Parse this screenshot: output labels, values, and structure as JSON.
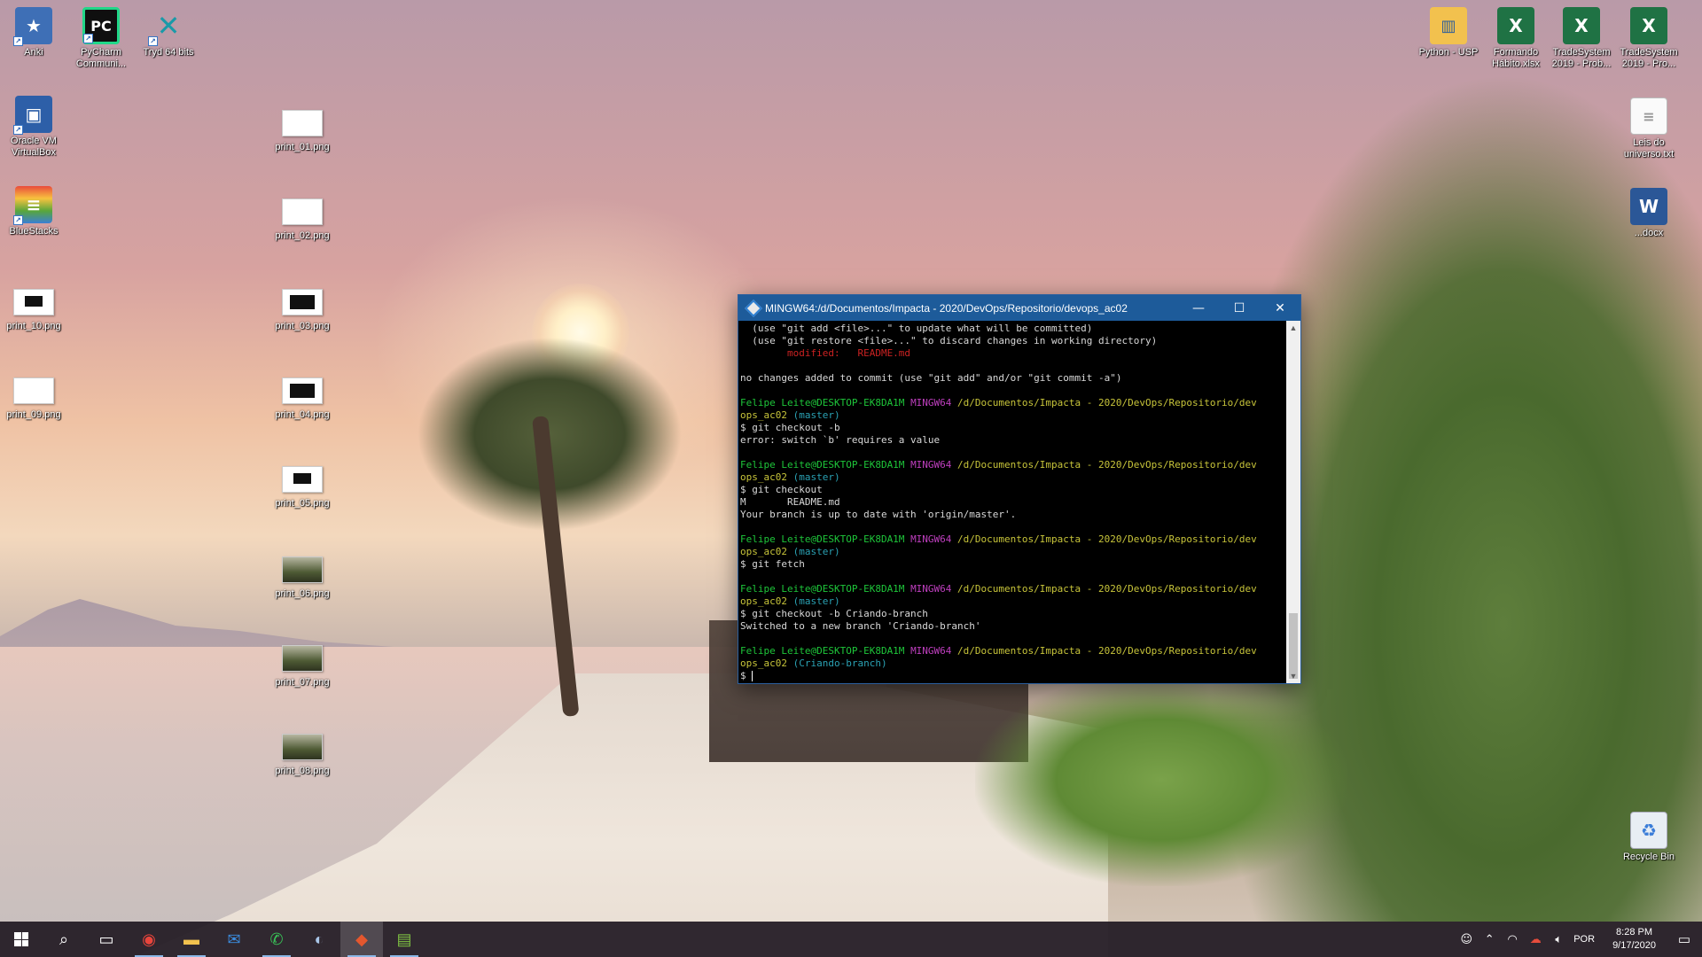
{
  "desktop": {
    "icons_left": [
      {
        "label": "Anki",
        "icon": "anki-icon",
        "color": "#3e6fb6"
      },
      {
        "label": "PyCharm Communi...",
        "icon": "pycharm-icon",
        "color": "#0f0f0f"
      },
      {
        "label": "Tryd 64 bits",
        "icon": "tryd-icon",
        "color": "#1a7f8a"
      },
      {
        "label": "Oracle VM VirtualBox",
        "icon": "virtualbox-icon",
        "color": "#2d5fa8"
      },
      {
        "label": "BlueStacks",
        "icon": "bluestacks-icon",
        "color": "#58a63b"
      },
      {
        "label": "print_10.png",
        "icon": "image-file-icon"
      },
      {
        "label": "print_09.png",
        "icon": "image-file-icon"
      }
    ],
    "icons_prints": [
      {
        "label": "print_01.png"
      },
      {
        "label": "print_02.png"
      },
      {
        "label": "print_03.png"
      },
      {
        "label": "print_04.png"
      },
      {
        "label": "print_05.png"
      },
      {
        "label": "print_06.png"
      },
      {
        "label": "print_07.png"
      },
      {
        "label": "print_08.png"
      }
    ],
    "icons_right": [
      {
        "label": "Python - USP",
        "icon": "folder-icon"
      },
      {
        "label": "Formando Hábito.xlsx",
        "icon": "excel-icon"
      },
      {
        "label": "TradeSystem 2019 - Prob...",
        "icon": "excel-icon"
      },
      {
        "label": "TradeSystem 2019 - Pro...",
        "icon": "excel-icon"
      },
      {
        "label": "Leis do universo.txt",
        "icon": "text-file-icon"
      },
      {
        "label": "...docx",
        "icon": "word-icon"
      },
      {
        "label": "Recycle Bin",
        "icon": "recycle-bin-icon"
      }
    ]
  },
  "terminal": {
    "title": "MINGW64:/d/Documentos/Impacta - 2020/DevOps/Repositorio/devops_ac02",
    "minimize": "—",
    "maximize": "☐",
    "close": "✕",
    "lines": [
      {
        "text": "  (use \"git add <file>...\" to update what will be committed)"
      },
      {
        "text": "  (use \"git restore <file>...\" to discard changes in working directory)"
      },
      {
        "text": "        modified:   README.md",
        "color": "red"
      },
      {
        "text": ""
      },
      {
        "text": "no changes added to commit (use \"git add\" and/or \"git commit -a\")"
      },
      {
        "text": ""
      },
      {
        "prompt": true,
        "user": "Felipe Leite@DESKTOP-EK8DA1M",
        "env": "MINGW64",
        "path": "/d/Documentos/Impacta - 2020/DevOps/Repositorio/dev",
        "path2": "ops_ac02",
        "branch": "(master)"
      },
      {
        "text": "$ git checkout -b"
      },
      {
        "text": "error: switch `b' requires a value"
      },
      {
        "text": ""
      },
      {
        "prompt": true,
        "user": "Felipe Leite@DESKTOP-EK8DA1M",
        "env": "MINGW64",
        "path": "/d/Documentos/Impacta - 2020/DevOps/Repositorio/dev",
        "path2": "ops_ac02",
        "branch": "(master)"
      },
      {
        "text": "$ git checkout"
      },
      {
        "text": "M       README.md"
      },
      {
        "text": "Your branch is up to date with 'origin/master'."
      },
      {
        "text": ""
      },
      {
        "prompt": true,
        "user": "Felipe Leite@DESKTOP-EK8DA1M",
        "env": "MINGW64",
        "path": "/d/Documentos/Impacta - 2020/DevOps/Repositorio/dev",
        "path2": "ops_ac02",
        "branch": "(master)"
      },
      {
        "text": "$ git fetch"
      },
      {
        "text": ""
      },
      {
        "prompt": true,
        "user": "Felipe Leite@DESKTOP-EK8DA1M",
        "env": "MINGW64",
        "path": "/d/Documentos/Impacta - 2020/DevOps/Repositorio/dev",
        "path2": "ops_ac02",
        "branch": "(master)"
      },
      {
        "text": "$ git checkout -b Criando-branch"
      },
      {
        "text": "Switched to a new branch 'Criando-branch'"
      },
      {
        "text": ""
      },
      {
        "prompt": true,
        "user": "Felipe Leite@DESKTOP-EK8DA1M",
        "env": "MINGW64",
        "path": "/d/Documentos/Impacta - 2020/DevOps/Repositorio/dev",
        "path2": "ops_ac02",
        "branch": "(Criando-branch)"
      },
      {
        "text": "$ ",
        "cursor": true
      }
    ]
  },
  "taskbar": {
    "apps": [
      {
        "icon": "start-icon"
      },
      {
        "icon": "search-icon",
        "glyph": "⌕"
      },
      {
        "icon": "task-view-icon",
        "glyph": "▭"
      },
      {
        "icon": "chrome-icon",
        "glyph": "◉",
        "color": "#e8453c"
      },
      {
        "icon": "file-explorer-icon",
        "glyph": "▬",
        "color": "#f2c14e"
      },
      {
        "icon": "mail-icon",
        "glyph": "✉",
        "color": "#3b8de0"
      },
      {
        "icon": "whatsapp-icon",
        "glyph": "✆",
        "color": "#39c257"
      },
      {
        "icon": "pycharm-taskbar-icon",
        "glyph": "◐",
        "color": "#a9c6e8"
      },
      {
        "icon": "git-bash-icon",
        "glyph": "◆",
        "color": "#e4572e"
      },
      {
        "icon": "notepad-icon",
        "glyph": "▤",
        "color": "#7fc243"
      }
    ],
    "tray": {
      "lang": "POR",
      "time": "8:28 PM",
      "date": "9/17/2020"
    }
  }
}
